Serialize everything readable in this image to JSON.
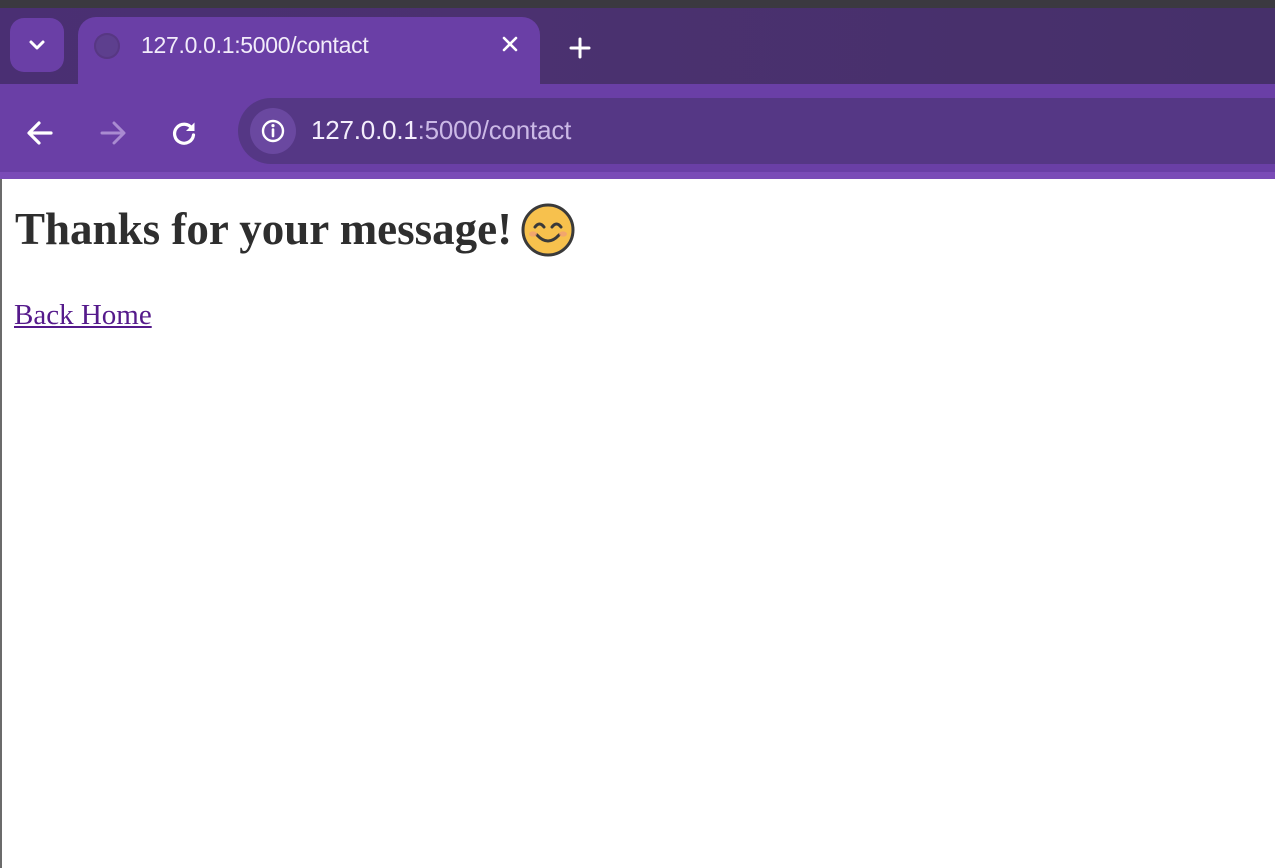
{
  "browser": {
    "tab": {
      "title": "127.0.0.1:5000/contact"
    },
    "address_bar": {
      "host": "127.0.0.1",
      "path": ":5000/contact"
    },
    "colors": {
      "frame": "#4a2f73",
      "active": "#6a3fa6",
      "omnibox": "#553785"
    },
    "icons": {
      "tab_search": "chevron-down-icon",
      "favicon": "globe-icon",
      "close": "close-icon",
      "new_tab": "plus-icon",
      "back": "arrow-left-icon",
      "forward": "arrow-right-icon",
      "reload": "reload-icon",
      "site_info": "info-icon"
    }
  },
  "page": {
    "heading": "Thanks for your message!",
    "emoji": "smiling-face-icon",
    "link": "Back Home",
    "link_color": "#551a8b"
  }
}
